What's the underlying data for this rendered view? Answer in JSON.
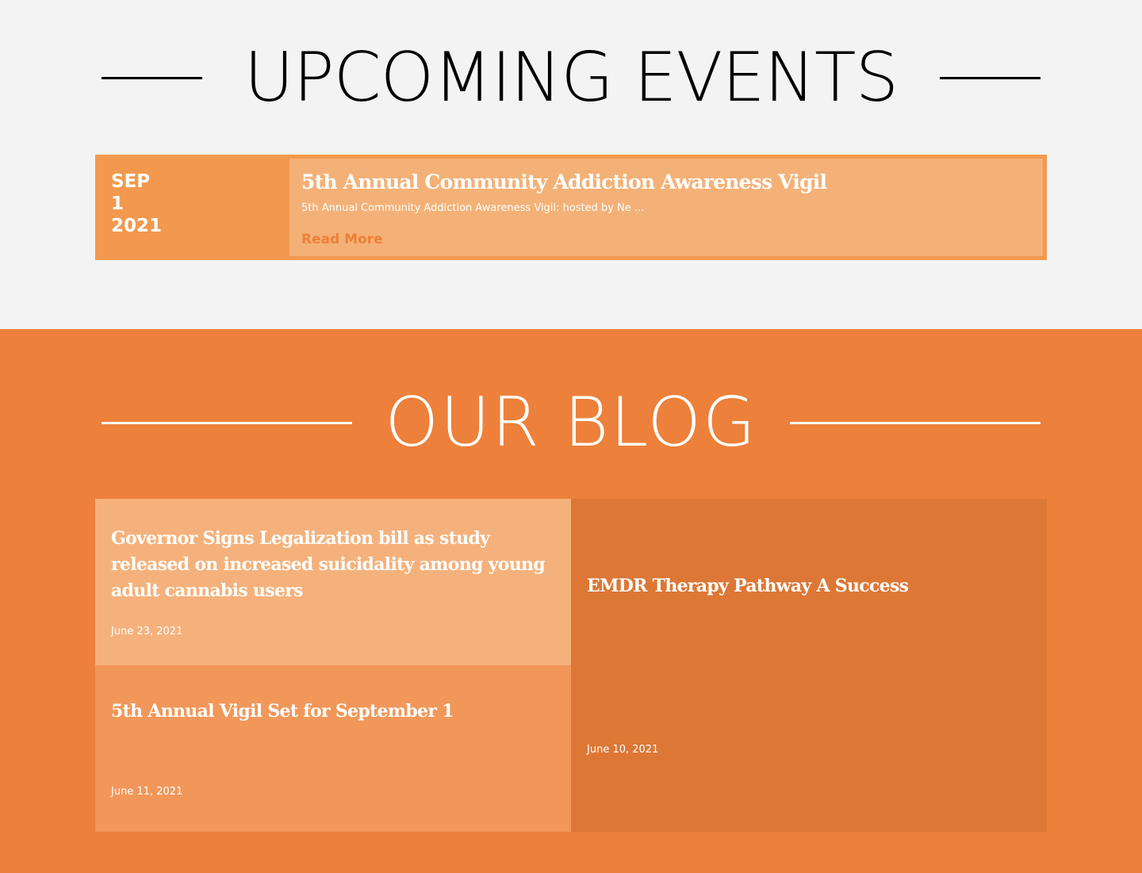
{
  "events": {
    "heading": "UPCOMING EVENTS",
    "items": [
      {
        "month": "SEP",
        "day": "1",
        "year": "2021",
        "title": "5th Annual Community Addiction Awareness Vigil",
        "excerpt": "5th Annual Community Addiction Awareness Vigil: hosted by Ne ...",
        "read_more": "Read More"
      }
    ]
  },
  "blog": {
    "heading": "OUR BLOG",
    "posts": [
      {
        "title": "Governor Signs Legalization bill as study released on increased suicidality among young adult cannabis users",
        "date": "June 23, 2021"
      },
      {
        "title": "EMDR Therapy Pathway A Success",
        "date": "June 10, 2021"
      },
      {
        "title": "5th Annual Vigil Set for September 1",
        "date": "June 11, 2021"
      }
    ]
  },
  "colors": {
    "page_background": "#f3f3f3",
    "blog_background": "#ed803a",
    "event_card": "#f2994e",
    "event_body": "#f4b177",
    "read_more": "#ee7f38"
  }
}
